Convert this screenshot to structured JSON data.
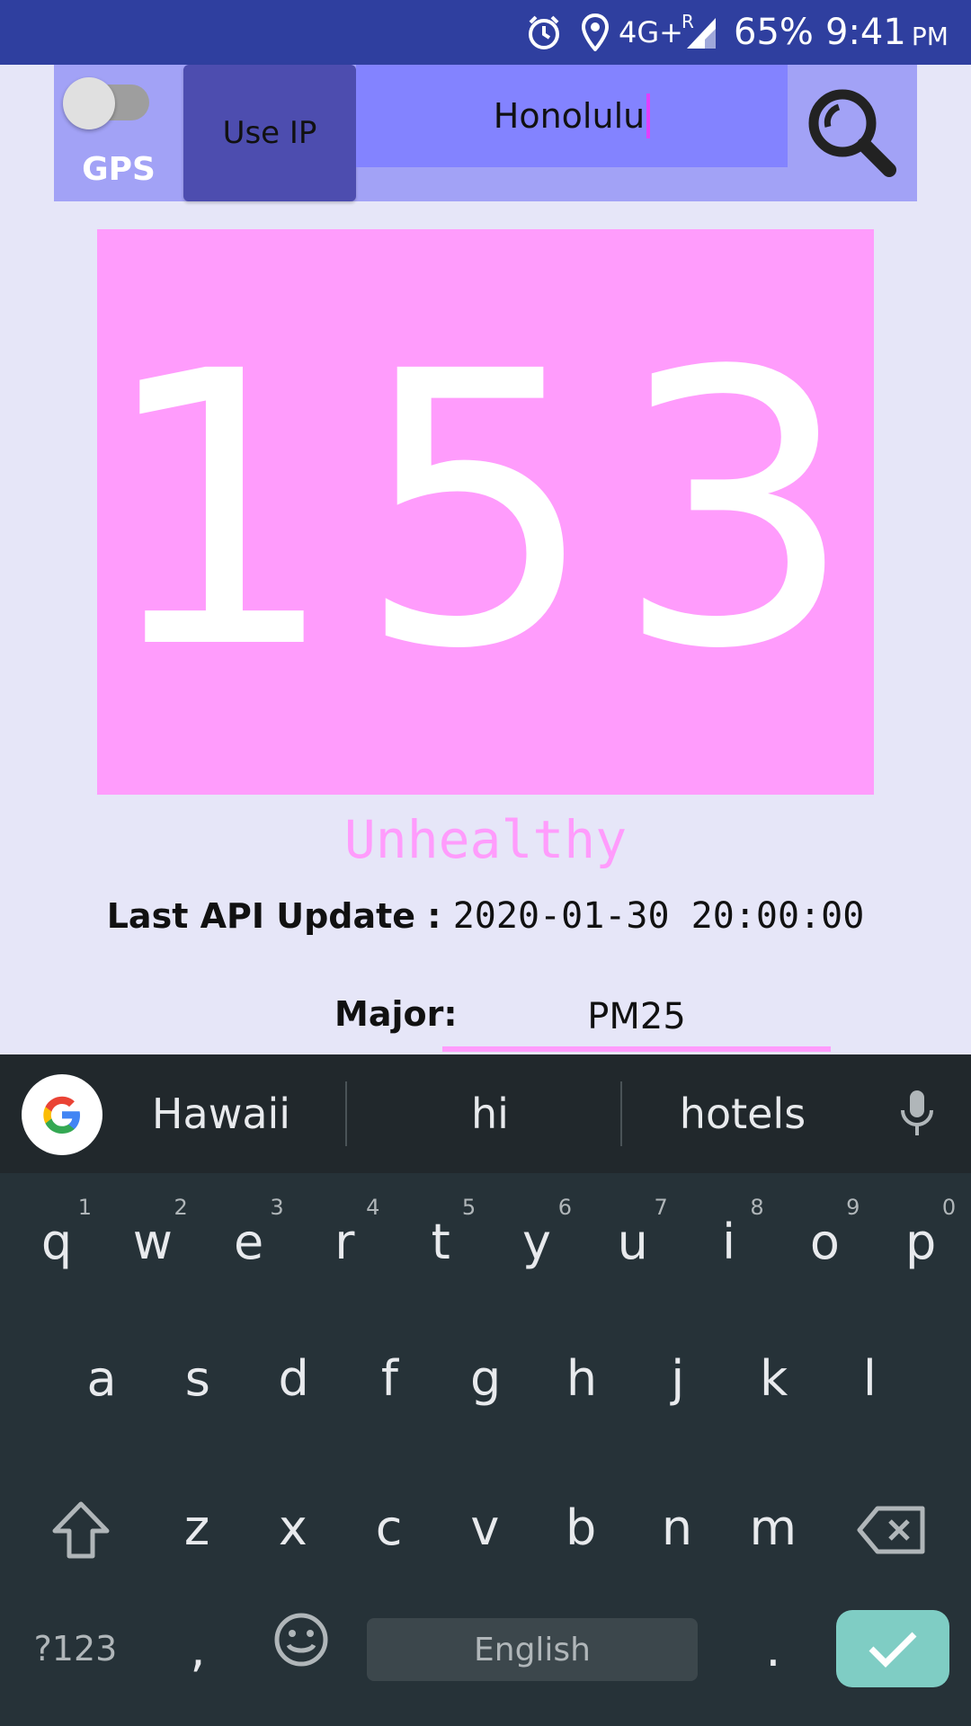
{
  "status_bar": {
    "network": "4G+",
    "roaming": "R",
    "battery": "65%",
    "time": "9:41",
    "ampm": "PM",
    "icons": [
      "alarm-icon",
      "location-pin-icon",
      "signal-icon"
    ]
  },
  "controls": {
    "gps_label": "GPS",
    "gps_enabled": false,
    "use_ip_label": "Use IP",
    "city_value": "Honolulu",
    "search_icon": "magnifier-icon"
  },
  "aqi": {
    "value": "153",
    "status": "Unhealthy",
    "color": "#ff9cfc"
  },
  "update": {
    "label": "Last API Update : ",
    "value": "2020-01-30 20:00:00"
  },
  "major": {
    "label": "Major:",
    "value": "PM25"
  },
  "keyboard": {
    "suggestions": [
      "Hawaii",
      "hi",
      "hotels"
    ],
    "row1": [
      {
        "k": "q",
        "n": "1"
      },
      {
        "k": "w",
        "n": "2"
      },
      {
        "k": "e",
        "n": "3"
      },
      {
        "k": "r",
        "n": "4"
      },
      {
        "k": "t",
        "n": "5"
      },
      {
        "k": "y",
        "n": "6"
      },
      {
        "k": "u",
        "n": "7"
      },
      {
        "k": "i",
        "n": "8"
      },
      {
        "k": "o",
        "n": "9"
      },
      {
        "k": "p",
        "n": "0"
      }
    ],
    "row2": [
      "a",
      "s",
      "d",
      "f",
      "g",
      "h",
      "j",
      "k",
      "l"
    ],
    "row3": [
      "z",
      "x",
      "c",
      "v",
      "b",
      "n",
      "m"
    ],
    "symbols_label": "?123",
    "comma_label": ",",
    "space_label": "English",
    "period_label": ".",
    "accent_color": "#7fcdc4"
  }
}
